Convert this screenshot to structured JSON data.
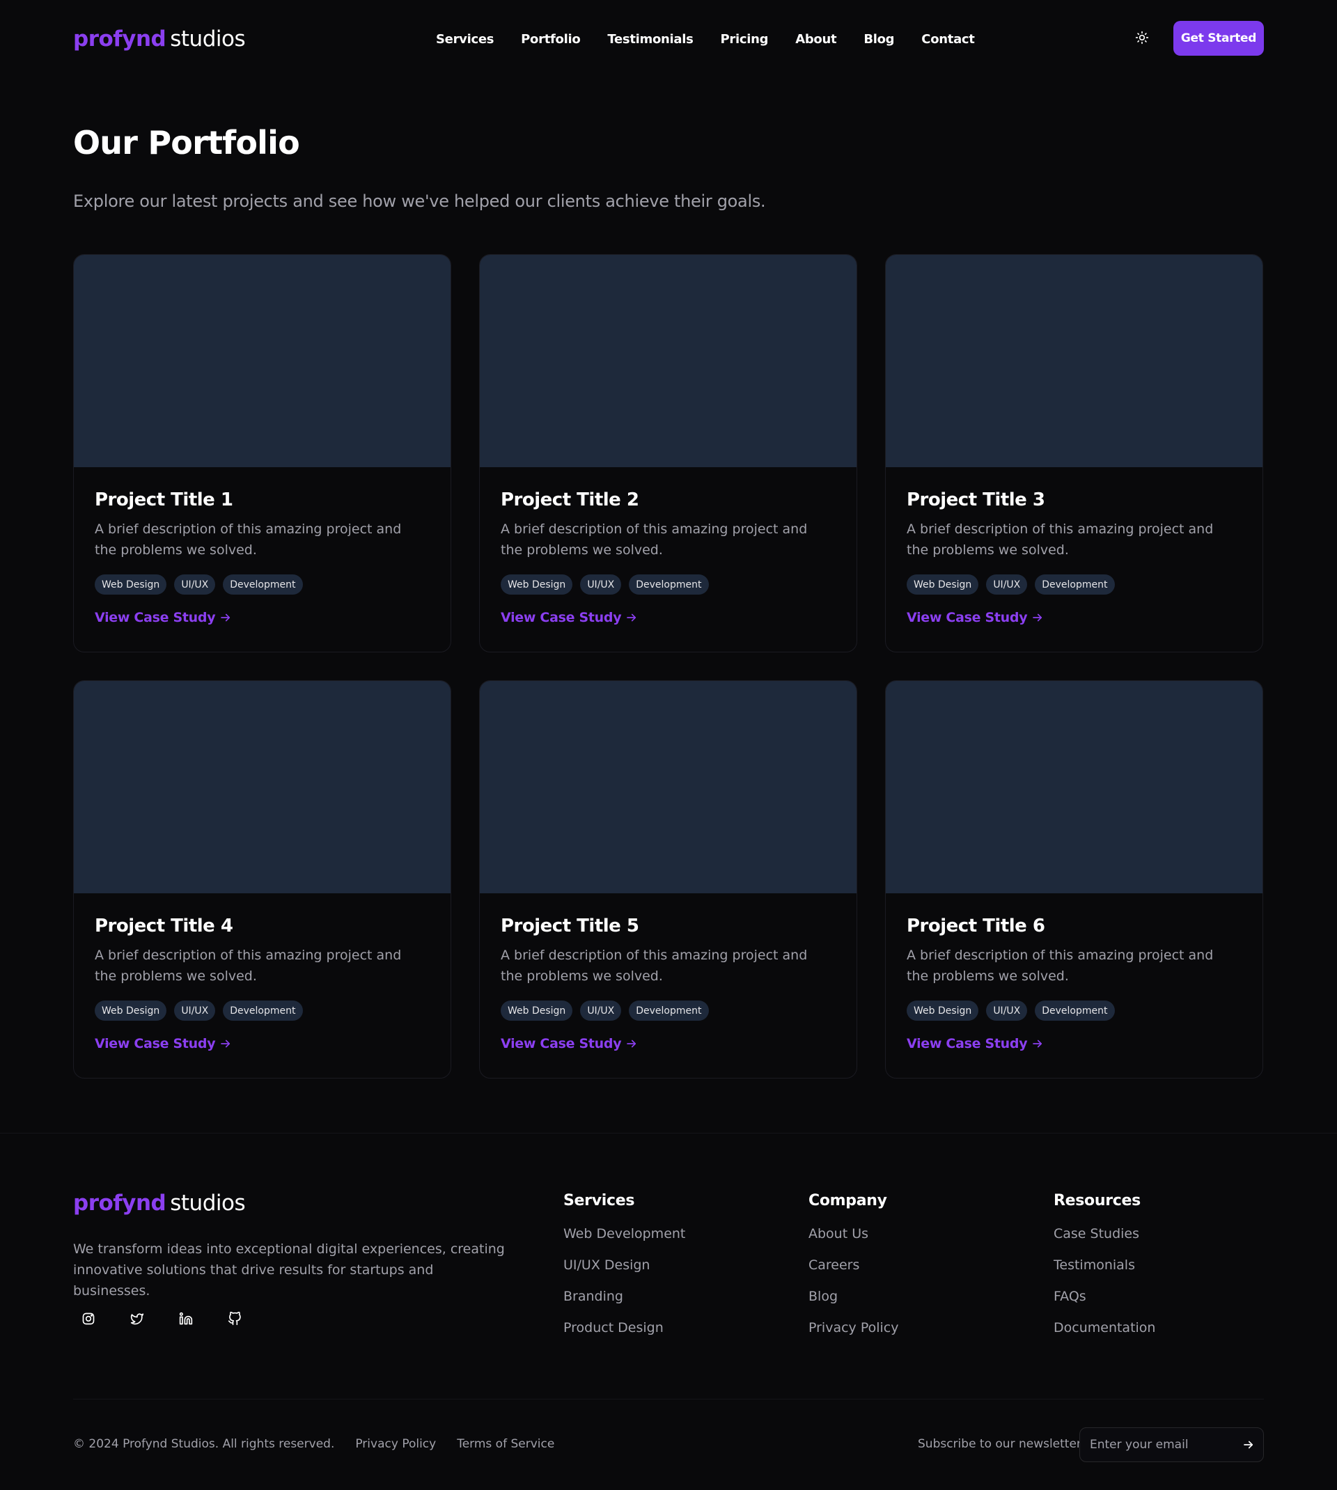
{
  "brand": {
    "name": "profynd",
    "suffix": "studios",
    "accent": "#8b3ff0"
  },
  "nav": {
    "items": [
      "Services",
      "Portfolio",
      "Testimonials",
      "Pricing",
      "About",
      "Blog",
      "Contact"
    ],
    "cta": "Get Started"
  },
  "hero": {
    "title": "Our Portfolio",
    "subtitle": "Explore our latest projects and see how we've helped our clients achieve their goals."
  },
  "projects": [
    {
      "title": "Project Title 1",
      "description": "A brief description of this amazing project and the problems we solved.",
      "tags": [
        "Web Design",
        "UI/UX",
        "Development"
      ],
      "link": "View Case Study"
    },
    {
      "title": "Project Title 2",
      "description": "A brief description of this amazing project and the problems we solved.",
      "tags": [
        "Web Design",
        "UI/UX",
        "Development"
      ],
      "link": "View Case Study"
    },
    {
      "title": "Project Title 3",
      "description": "A brief description of this amazing project and the problems we solved.",
      "tags": [
        "Web Design",
        "UI/UX",
        "Development"
      ],
      "link": "View Case Study"
    },
    {
      "title": "Project Title 4",
      "description": "A brief description of this amazing project and the problems we solved.",
      "tags": [
        "Web Design",
        "UI/UX",
        "Development"
      ],
      "link": "View Case Study"
    },
    {
      "title": "Project Title 5",
      "description": "A brief description of this amazing project and the problems we solved.",
      "tags": [
        "Web Design",
        "UI/UX",
        "Development"
      ],
      "link": "View Case Study"
    },
    {
      "title": "Project Title 6",
      "description": "A brief description of this amazing project and the problems we solved.",
      "tags": [
        "Web Design",
        "UI/UX",
        "Development"
      ],
      "link": "View Case Study"
    }
  ],
  "footer": {
    "about": "We transform ideas into exceptional digital experiences, creating innovative solutions that drive results for startups and businesses.",
    "socials": [
      "instagram-icon",
      "twitter-icon",
      "linkedin-icon",
      "github-icon"
    ],
    "columns": [
      {
        "title": "Services",
        "links": [
          "Web Development",
          "UI/UX Design",
          "Branding",
          "Product Design"
        ]
      },
      {
        "title": "Company",
        "links": [
          "About Us",
          "Careers",
          "Blog",
          "Privacy Policy"
        ]
      },
      {
        "title": "Resources",
        "links": [
          "Case Studies",
          "Testimonials",
          "FAQs",
          "Documentation"
        ]
      }
    ],
    "copyright": "© 2024 Profynd Studios. All rights reserved.",
    "privacy": "Privacy Policy",
    "terms": "Terms of Service",
    "newsletter_label": "Subscribe to our newsletter",
    "newsletter_placeholder": "Enter your email"
  }
}
